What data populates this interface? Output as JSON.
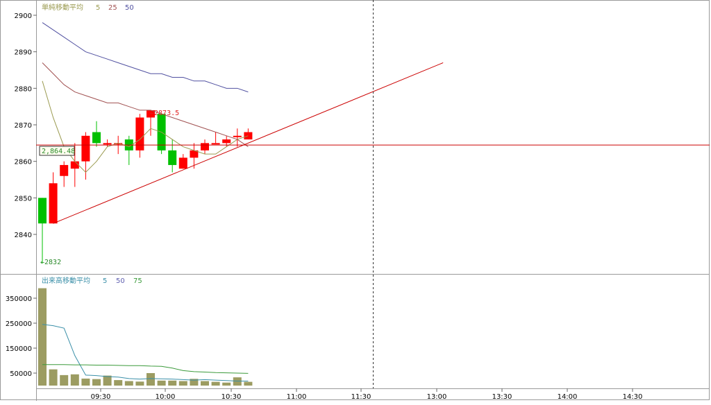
{
  "price_panel": {
    "legend_label": "単純移動平均",
    "legend_periods": [
      "5",
      "25",
      "50"
    ],
    "legend_colors": [
      "#9a9a50",
      "#a05050",
      "#5050a0"
    ],
    "y_ticks": [
      "2900",
      "2890",
      "2880",
      "2870",
      "2860",
      "2850",
      "2840"
    ],
    "current_price_label": "2,864.48",
    "high_annotation": "←2873.5",
    "low_annotation": "←2832"
  },
  "volume_panel": {
    "legend_label": "出来高移動平均",
    "legend_periods": [
      "5",
      "50",
      "75"
    ],
    "legend_colors": [
      "#3a8fa8",
      "#6060b0",
      "#3a9a3a"
    ],
    "y_ticks": [
      "350000",
      "250000",
      "150000",
      "50000"
    ]
  },
  "x_ticks": [
    "09:30",
    "10:00",
    "10:30",
    "11:00",
    "11:30",
    "13:00",
    "13:30",
    "14:00",
    "14:30"
  ],
  "colors": {
    "up": "#ff0000",
    "down": "#00c000",
    "volume_bar": "#9c9c62",
    "trendline": "#cc0000",
    "hline": "#cc0000",
    "crosshair": "#333333"
  },
  "chart_data": [
    {
      "type": "candlestick",
      "title": "",
      "ylim": [
        2826,
        2902
      ],
      "candles": [
        {
          "o": 2850,
          "h": 2850,
          "c": 2843,
          "l": 2832
        },
        {
          "o": 2843,
          "h": 2857,
          "c": 2854,
          "l": 2843
        },
        {
          "o": 2856,
          "h": 2860,
          "c": 2859,
          "l": 2853
        },
        {
          "o": 2858,
          "h": 2865,
          "c": 2860,
          "l": 2853
        },
        {
          "o": 2860,
          "h": 2868,
          "c": 2867,
          "l": 2855
        },
        {
          "o": 2868,
          "h": 2871,
          "c": 2865,
          "l": 2864
        },
        {
          "o": 2865,
          "h": 2866,
          "c": 2865,
          "l": 2864
        },
        {
          "o": 2865,
          "h": 2867,
          "c": 2865,
          "l": 2862
        },
        {
          "o": 2866,
          "h": 2867,
          "c": 2863,
          "l": 2859
        },
        {
          "o": 2863,
          "h": 2873,
          "c": 2872,
          "l": 2861
        },
        {
          "o": 2872,
          "h": 2873.5,
          "c": 2874,
          "l": 2867
        },
        {
          "o": 2873,
          "h": 2873,
          "c": 2863,
          "l": 2862
        },
        {
          "o": 2863,
          "h": 2866,
          "c": 2859,
          "l": 2857
        },
        {
          "o": 2858,
          "h": 2862,
          "c": 2861,
          "l": 2858
        },
        {
          "o": 2861,
          "h": 2865,
          "c": 2863,
          "l": 2858
        },
        {
          "o": 2863,
          "h": 2866,
          "c": 2865,
          "l": 2862
        },
        {
          "o": 2865,
          "h": 2868,
          "c": 2865,
          "l": 2865
        },
        {
          "o": 2865,
          "h": 2867,
          "c": 2866,
          "l": 2864
        },
        {
          "o": 2867,
          "h": 2869,
          "c": 2867,
          "l": 2864
        },
        {
          "o": 2866,
          "h": 2869,
          "c": 2868,
          "l": 2866
        }
      ],
      "ma_series": [
        {
          "values": [
            2882,
            2872,
            2864,
            2860,
            2857,
            2860,
            2864,
            2865,
            2864,
            2866,
            2869,
            2868,
            2866,
            2864,
            2863,
            2862,
            2862,
            2864,
            2866,
            2867
          ],
          "start_index": 0
        },
        {
          "values": [
            2887,
            2884,
            2881,
            2879,
            2878,
            2877,
            2876,
            2876,
            2875,
            2874,
            2874,
            2873,
            2872,
            2871,
            2870,
            2869,
            2868,
            2867,
            2866,
            2864
          ],
          "start_index": 0
        },
        {
          "values": [
            2898,
            2896,
            2894,
            2892,
            2890,
            2889,
            2888,
            2887,
            2886,
            2885,
            2884,
            2884,
            2883,
            2883,
            2882,
            2882,
            2881,
            2880,
            2880,
            2879
          ],
          "start_index": 0
        }
      ],
      "trendline": {
        "from": {
          "index": 1,
          "value": 2843
        },
        "to": {
          "index": 37,
          "value": 2887
        }
      },
      "hline_value": 2864.48
    },
    {
      "type": "bar",
      "title": "",
      "ylim": [
        0,
        400000
      ],
      "values": [
        390000,
        65000,
        42000,
        45000,
        28000,
        26000,
        40000,
        22000,
        18000,
        16000,
        50000,
        20000,
        20000,
        18000,
        27000,
        18000,
        15000,
        12000,
        33000,
        15000
      ],
      "ma_series": [
        {
          "values": [
            245000,
            240000,
            230000,
            120000,
            42000,
            40000,
            36000,
            34000,
            28000,
            26000,
            28000,
            27000,
            26000,
            24000,
            22000,
            24000,
            22000,
            20000,
            18000,
            18000
          ]
        },
        {
          "values": [
            84000,
            84000,
            84000,
            83000,
            83000,
            82000,
            82000,
            81000,
            80000,
            80000,
            78000,
            77000,
            70000,
            60000,
            56000,
            54000,
            52000,
            51000,
            50000,
            49000
          ]
        }
      ]
    }
  ]
}
